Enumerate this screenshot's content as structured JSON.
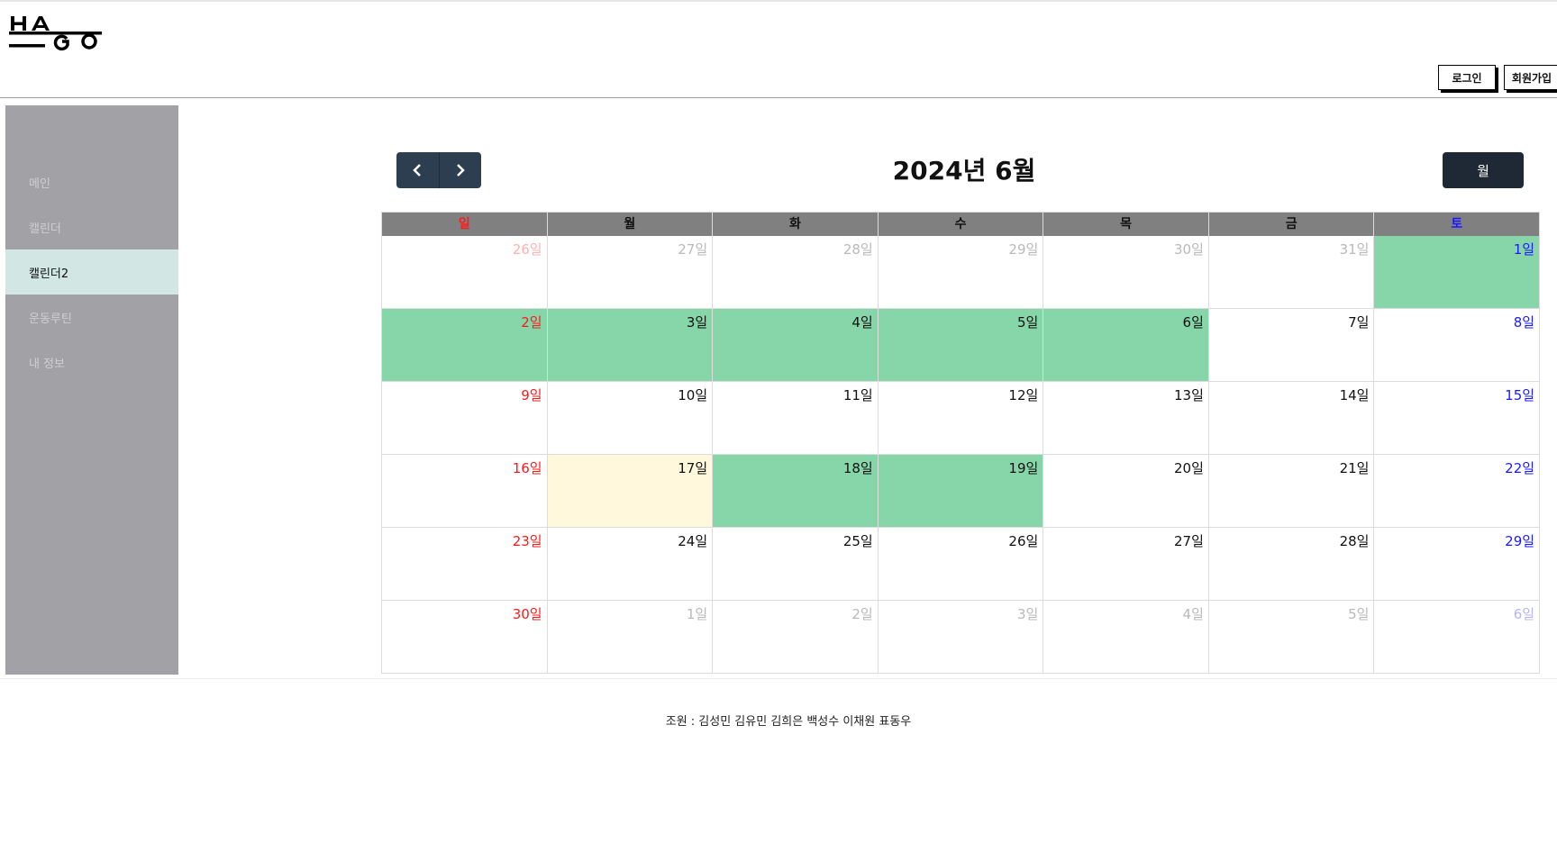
{
  "header": {
    "logo_text": "HAGO",
    "login_label": "로그인",
    "signup_label": "회원가입"
  },
  "sidebar": {
    "items": [
      {
        "label": "메인",
        "active": false
      },
      {
        "label": "캘린더",
        "active": false
      },
      {
        "label": "캘린더2",
        "active": true
      },
      {
        "label": "운동루틴",
        "active": false
      },
      {
        "label": "내 정보",
        "active": false
      }
    ]
  },
  "calendar": {
    "title": "2024년 6월",
    "view_label": "월",
    "prev_icon": "chevron-left-icon",
    "next_icon": "chevron-right-icon",
    "weekdays": [
      "일",
      "월",
      "화",
      "수",
      "목",
      "금",
      "토"
    ],
    "weeks": [
      [
        {
          "label": "26일",
          "other": true
        },
        {
          "label": "27일",
          "other": true
        },
        {
          "label": "28일",
          "other": true
        },
        {
          "label": "29일",
          "other": true
        },
        {
          "label": "30일",
          "other": true
        },
        {
          "label": "31일",
          "other": true
        },
        {
          "label": "1일",
          "highlight": "green"
        }
      ],
      [
        {
          "label": "2일",
          "highlight": "green"
        },
        {
          "label": "3일",
          "highlight": "green"
        },
        {
          "label": "4일",
          "highlight": "green"
        },
        {
          "label": "5일",
          "highlight": "green"
        },
        {
          "label": "6일",
          "highlight": "green"
        },
        {
          "label": "7일"
        },
        {
          "label": "8일"
        }
      ],
      [
        {
          "label": "9일"
        },
        {
          "label": "10일"
        },
        {
          "label": "11일"
        },
        {
          "label": "12일"
        },
        {
          "label": "13일"
        },
        {
          "label": "14일"
        },
        {
          "label": "15일"
        }
      ],
      [
        {
          "label": "16일"
        },
        {
          "label": "17일",
          "highlight": "today"
        },
        {
          "label": "18일",
          "highlight": "green"
        },
        {
          "label": "19일",
          "highlight": "green"
        },
        {
          "label": "20일"
        },
        {
          "label": "21일"
        },
        {
          "label": "22일"
        }
      ],
      [
        {
          "label": "23일"
        },
        {
          "label": "24일"
        },
        {
          "label": "25일"
        },
        {
          "label": "26일"
        },
        {
          "label": "27일"
        },
        {
          "label": "28일"
        },
        {
          "label": "29일"
        }
      ],
      [
        {
          "label": "30일"
        },
        {
          "label": "1일",
          "other": true
        },
        {
          "label": "2일",
          "other": true
        },
        {
          "label": "3일",
          "other": true
        },
        {
          "label": "4일",
          "other": true
        },
        {
          "label": "5일",
          "other": true
        },
        {
          "label": "6일",
          "other": true
        }
      ]
    ]
  },
  "footer": {
    "credits": "조원 : 김성민 김유민 김희은 백성수 이채원 표동우"
  },
  "colors": {
    "sidebar_bg": "#a2a1a6",
    "sidebar_active": "#d2e6e3",
    "event_green": "#86d6a9",
    "today_bg": "#fff8dd",
    "nav_button": "#2c3e50",
    "sunday": "#ff1a1a",
    "saturday": "#1a1aff"
  }
}
